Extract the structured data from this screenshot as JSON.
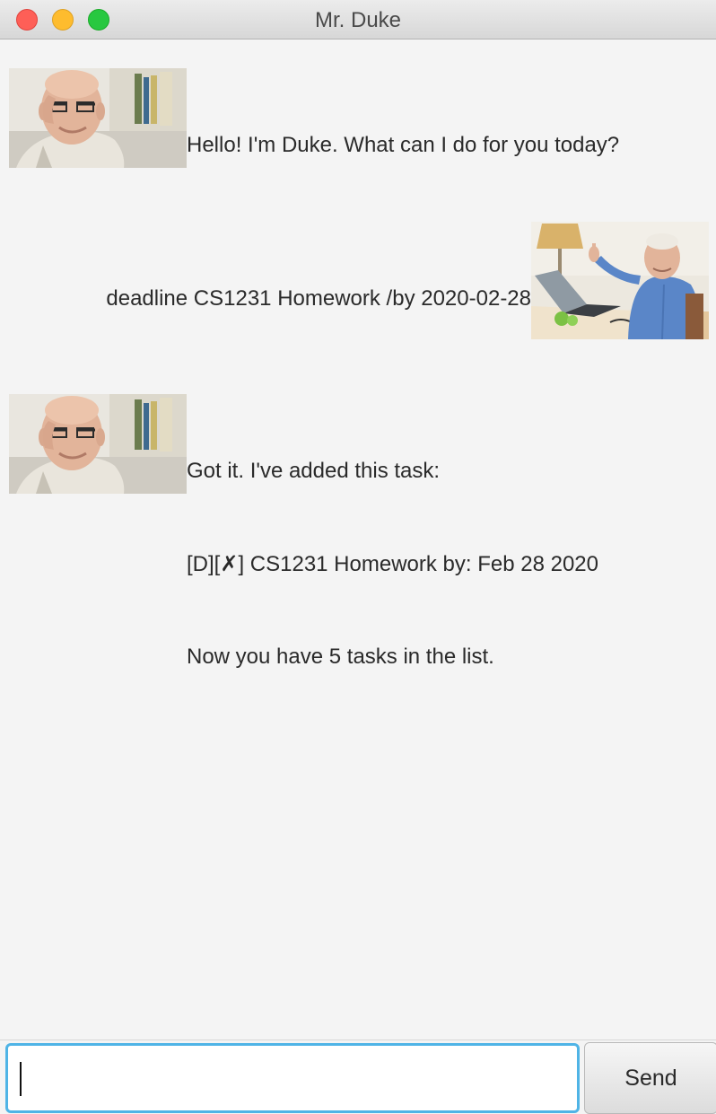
{
  "window": {
    "title": "Mr. Duke",
    "controls": [
      "close",
      "minimize",
      "maximize"
    ]
  },
  "chat": {
    "messages": [
      {
        "sender": "duke",
        "avatar": "duke-avatar",
        "lines": [
          "Hello! I'm Duke. What can I do for you today?"
        ]
      },
      {
        "sender": "user",
        "avatar": "user-avatar",
        "lines": [
          "deadline CS1231 Homework /by 2020-02-28"
        ]
      },
      {
        "sender": "duke",
        "avatar": "duke-avatar",
        "lines": [
          "Got it. I've added this task:",
          "[D][✗] CS1231 Homework by: Feb 28 2020",
          "Now you have 5 tasks in the list."
        ]
      }
    ]
  },
  "input": {
    "value": "",
    "placeholder": ""
  },
  "send_button": {
    "label": "Send"
  },
  "colors": {
    "background": "#f4f4f4",
    "input_focus": "#4fb4e6",
    "close": "#fe5f57",
    "minimize": "#febc2e",
    "maximize": "#28c840"
  }
}
